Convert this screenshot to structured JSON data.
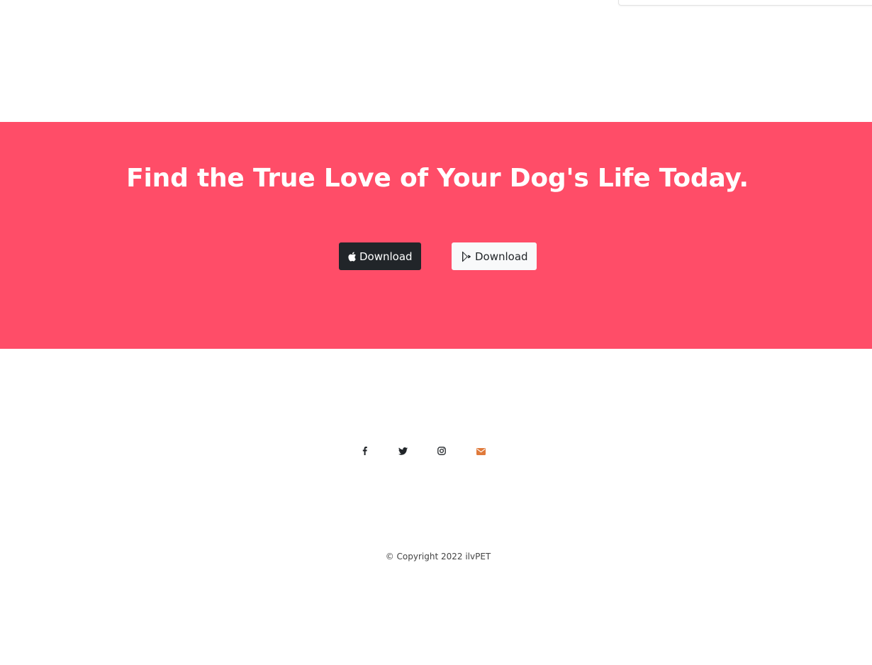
{
  "cta": {
    "title": "Find the True Love of Your Dog's Life Today.",
    "background": "#ff4d68",
    "apple_button": {
      "label": "Download",
      "icon": "apple-icon"
    },
    "play_button": {
      "label": "Download",
      "icon": "google-play-icon"
    }
  },
  "footer": {
    "social_icons": [
      "facebook-icon",
      "twitter-icon",
      "instagram-icon",
      "envelope-icon"
    ],
    "email_icon_color": "#e07a3b",
    "copyright": "© Copyright 2022 ilvPET"
  }
}
